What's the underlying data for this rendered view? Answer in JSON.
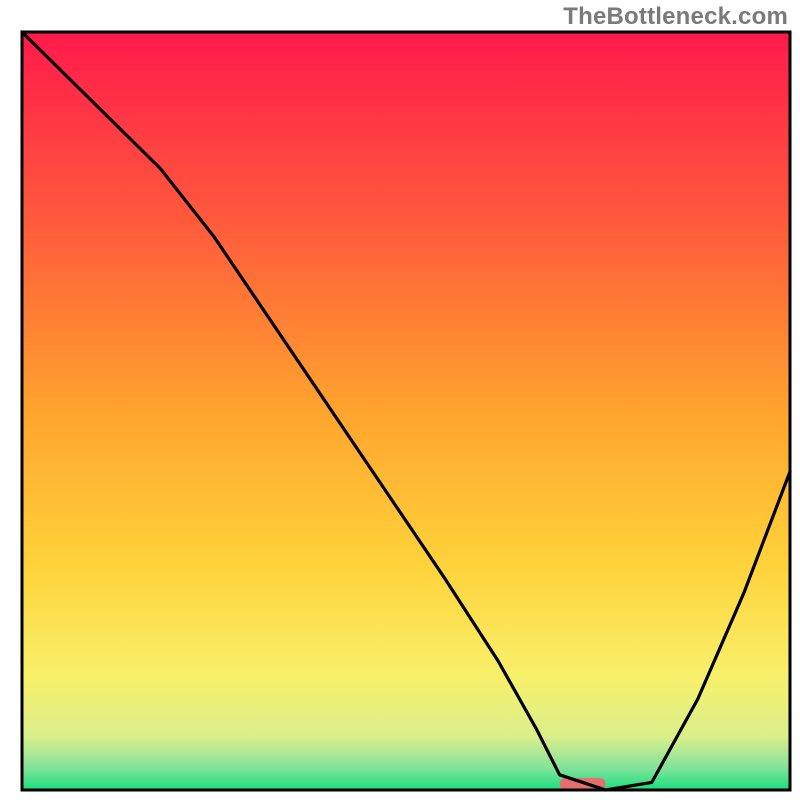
{
  "watermark": "TheBottleneck.com",
  "chart_data": {
    "type": "line",
    "title": "",
    "xlabel": "",
    "ylabel": "",
    "xlim": [
      0,
      100
    ],
    "ylim": [
      0,
      100
    ],
    "background_gradient": {
      "orientation": "vertical",
      "stops": [
        {
          "offset": 0.0,
          "color": "#ff1a4b"
        },
        {
          "offset": 0.25,
          "color": "#ff5a3c"
        },
        {
          "offset": 0.5,
          "color": "#ffa42e"
        },
        {
          "offset": 0.7,
          "color": "#ffd23a"
        },
        {
          "offset": 0.85,
          "color": "#f8f06a"
        },
        {
          "offset": 0.93,
          "color": "#d9ef8b"
        },
        {
          "offset": 0.97,
          "color": "#86e29b"
        },
        {
          "offset": 1.0,
          "color": "#18e07e"
        }
      ]
    },
    "series": [
      {
        "name": "bottleneck-curve",
        "color": "#000000",
        "x": [
          0,
          8,
          18,
          25,
          35,
          45,
          55,
          62,
          67,
          70,
          76,
          82,
          88,
          94,
          100
        ],
        "y": [
          100,
          92,
          82,
          73,
          58,
          43,
          28,
          17,
          8,
          2,
          0,
          1,
          12,
          26,
          42
        ]
      }
    ],
    "marker": {
      "name": "lowest-point-marker",
      "color": "#e46f6c",
      "x_start": 70,
      "x_end": 76,
      "y": 0,
      "height": 1.6
    },
    "axes": {
      "frame_color": "#000000",
      "frame_width": 3
    }
  }
}
